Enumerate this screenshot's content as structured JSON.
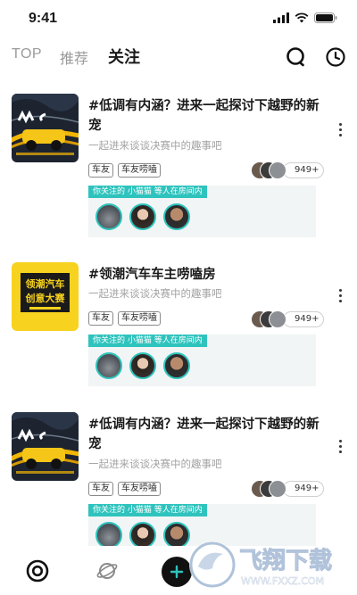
{
  "status": {
    "time": "9:41"
  },
  "tabs": [
    {
      "label": "TOP"
    },
    {
      "label": "推荐"
    },
    {
      "label": "关注"
    }
  ],
  "cards": [
    {
      "title": "#低调有内涵？进来一起探讨下越野的新宠",
      "subtitle": "一起进来谈谈决赛中的趣事吧",
      "tags": [
        "车友",
        "车友唠嗑"
      ],
      "count": "949+",
      "room_label": "你关注的 小猫猫 等人在房间内",
      "thumb": "mc-poster"
    },
    {
      "title": "#领潮汽车车主唠嗑房",
      "subtitle": "一起进来谈谈决赛中的趣事吧",
      "tags": [
        "车友",
        "车友唠嗑"
      ],
      "count": "949+",
      "room_label": "你关注的 小猫猫 等人在房间内",
      "thumb": "yellow-poster",
      "thumb_text": [
        "领潮汽车",
        "创意大赛"
      ]
    },
    {
      "title": "#低调有内涵？进来一起探讨下越野的新宠",
      "subtitle": "一起进来谈谈决赛中的趣事吧",
      "tags": [
        "车友",
        "车友唠嗑"
      ],
      "count": "949+",
      "room_label": "你关注的 小猫猫 等人在房间内",
      "thumb": "mc-poster"
    }
  ],
  "watermark": {
    "text": "飞翔下载",
    "url": "WWW.FXXZ.COM"
  },
  "colors": {
    "accent": "#2ec3bd",
    "highlight": "#22d3c5"
  }
}
